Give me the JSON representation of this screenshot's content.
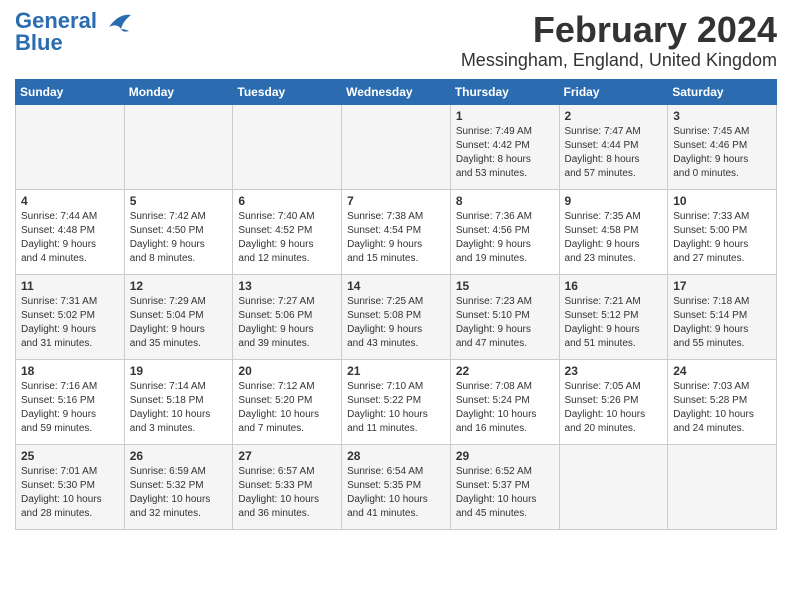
{
  "logo": {
    "line1": "General",
    "line2": "Blue"
  },
  "title": "February 2024",
  "subtitle": "Messingham, England, United Kingdom",
  "days_of_week": [
    "Sunday",
    "Monday",
    "Tuesday",
    "Wednesday",
    "Thursday",
    "Friday",
    "Saturday"
  ],
  "weeks": [
    [
      {
        "day": "",
        "content": ""
      },
      {
        "day": "",
        "content": ""
      },
      {
        "day": "",
        "content": ""
      },
      {
        "day": "",
        "content": ""
      },
      {
        "day": "1",
        "content": "Sunrise: 7:49 AM\nSunset: 4:42 PM\nDaylight: 8 hours\nand 53 minutes."
      },
      {
        "day": "2",
        "content": "Sunrise: 7:47 AM\nSunset: 4:44 PM\nDaylight: 8 hours\nand 57 minutes."
      },
      {
        "day": "3",
        "content": "Sunrise: 7:45 AM\nSunset: 4:46 PM\nDaylight: 9 hours\nand 0 minutes."
      }
    ],
    [
      {
        "day": "4",
        "content": "Sunrise: 7:44 AM\nSunset: 4:48 PM\nDaylight: 9 hours\nand 4 minutes."
      },
      {
        "day": "5",
        "content": "Sunrise: 7:42 AM\nSunset: 4:50 PM\nDaylight: 9 hours\nand 8 minutes."
      },
      {
        "day": "6",
        "content": "Sunrise: 7:40 AM\nSunset: 4:52 PM\nDaylight: 9 hours\nand 12 minutes."
      },
      {
        "day": "7",
        "content": "Sunrise: 7:38 AM\nSunset: 4:54 PM\nDaylight: 9 hours\nand 15 minutes."
      },
      {
        "day": "8",
        "content": "Sunrise: 7:36 AM\nSunset: 4:56 PM\nDaylight: 9 hours\nand 19 minutes."
      },
      {
        "day": "9",
        "content": "Sunrise: 7:35 AM\nSunset: 4:58 PM\nDaylight: 9 hours\nand 23 minutes."
      },
      {
        "day": "10",
        "content": "Sunrise: 7:33 AM\nSunset: 5:00 PM\nDaylight: 9 hours\nand 27 minutes."
      }
    ],
    [
      {
        "day": "11",
        "content": "Sunrise: 7:31 AM\nSunset: 5:02 PM\nDaylight: 9 hours\nand 31 minutes."
      },
      {
        "day": "12",
        "content": "Sunrise: 7:29 AM\nSunset: 5:04 PM\nDaylight: 9 hours\nand 35 minutes."
      },
      {
        "day": "13",
        "content": "Sunrise: 7:27 AM\nSunset: 5:06 PM\nDaylight: 9 hours\nand 39 minutes."
      },
      {
        "day": "14",
        "content": "Sunrise: 7:25 AM\nSunset: 5:08 PM\nDaylight: 9 hours\nand 43 minutes."
      },
      {
        "day": "15",
        "content": "Sunrise: 7:23 AM\nSunset: 5:10 PM\nDaylight: 9 hours\nand 47 minutes."
      },
      {
        "day": "16",
        "content": "Sunrise: 7:21 AM\nSunset: 5:12 PM\nDaylight: 9 hours\nand 51 minutes."
      },
      {
        "day": "17",
        "content": "Sunrise: 7:18 AM\nSunset: 5:14 PM\nDaylight: 9 hours\nand 55 minutes."
      }
    ],
    [
      {
        "day": "18",
        "content": "Sunrise: 7:16 AM\nSunset: 5:16 PM\nDaylight: 9 hours\nand 59 minutes."
      },
      {
        "day": "19",
        "content": "Sunrise: 7:14 AM\nSunset: 5:18 PM\nDaylight: 10 hours\nand 3 minutes."
      },
      {
        "day": "20",
        "content": "Sunrise: 7:12 AM\nSunset: 5:20 PM\nDaylight: 10 hours\nand 7 minutes."
      },
      {
        "day": "21",
        "content": "Sunrise: 7:10 AM\nSunset: 5:22 PM\nDaylight: 10 hours\nand 11 minutes."
      },
      {
        "day": "22",
        "content": "Sunrise: 7:08 AM\nSunset: 5:24 PM\nDaylight: 10 hours\nand 16 minutes."
      },
      {
        "day": "23",
        "content": "Sunrise: 7:05 AM\nSunset: 5:26 PM\nDaylight: 10 hours\nand 20 minutes."
      },
      {
        "day": "24",
        "content": "Sunrise: 7:03 AM\nSunset: 5:28 PM\nDaylight: 10 hours\nand 24 minutes."
      }
    ],
    [
      {
        "day": "25",
        "content": "Sunrise: 7:01 AM\nSunset: 5:30 PM\nDaylight: 10 hours\nand 28 minutes."
      },
      {
        "day": "26",
        "content": "Sunrise: 6:59 AM\nSunset: 5:32 PM\nDaylight: 10 hours\nand 32 minutes."
      },
      {
        "day": "27",
        "content": "Sunrise: 6:57 AM\nSunset: 5:33 PM\nDaylight: 10 hours\nand 36 minutes."
      },
      {
        "day": "28",
        "content": "Sunrise: 6:54 AM\nSunset: 5:35 PM\nDaylight: 10 hours\nand 41 minutes."
      },
      {
        "day": "29",
        "content": "Sunrise: 6:52 AM\nSunset: 5:37 PM\nDaylight: 10 hours\nand 45 minutes."
      },
      {
        "day": "",
        "content": ""
      },
      {
        "day": "",
        "content": ""
      }
    ]
  ]
}
